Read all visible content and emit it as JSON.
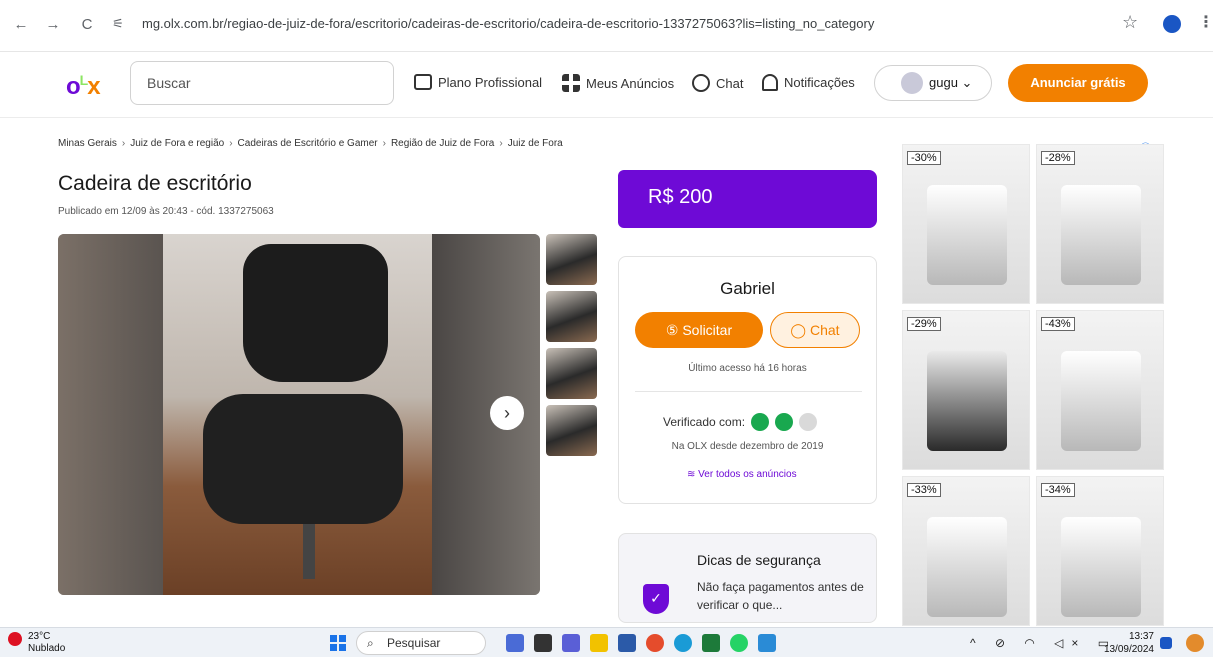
{
  "browser": {
    "url": "mg.olx.com.br/regiao-de-juiz-de-fora/escritorio/cadeiras-de-escritorio/cadeira-de-escritorio-1337275063?lis=listing_no_category",
    "back_icon": "←",
    "forward_icon": "→",
    "reload_icon": "C",
    "tune_icon": "⚟",
    "star_icon": "☆",
    "menu_icon": "⋮"
  },
  "header": {
    "search_placeholder": "Buscar",
    "nav": [
      "Plano Profissional",
      "Meus Anúncios",
      "Chat",
      "Notificações"
    ],
    "user": "gugu ⌄",
    "cta": "Anunciar grátis",
    "brand_colors": {
      "purple": "#6e0ad6",
      "orange": "#f28000",
      "green": "#8ce563"
    }
  },
  "breadcrumb": [
    "Minas Gerais",
    "Juiz de Fora e região",
    "Cadeiras de Escritório e Gamer",
    "Região de Juiz de Fora",
    "Juiz de Fora"
  ],
  "breadcrumb_sep": "›",
  "listing": {
    "title": "Cadeira de escritório",
    "published": "Publicado em 12/09 às 20:43 - cód. 1337275063",
    "price": "R$ 200",
    "next_icon": "›"
  },
  "seller": {
    "name": "Gabriel",
    "solicitar": "Solicitar",
    "chat": "Chat",
    "last_access": "Último acesso há 16 horas",
    "verified_label": "Verificado com:",
    "since": "Na OLX desde dezembro de 2019",
    "all_ads": "Ver todos os anúncios"
  },
  "tips": {
    "title": "Dicas de segurança",
    "text": "Não faça pagamentos antes de verificar o que..."
  },
  "ads": {
    "badges": [
      "-30%",
      "-28%",
      "-29%",
      "-43%",
      "-33%",
      "-34%"
    ],
    "info_icon": "ⓘ✕"
  },
  "taskbar": {
    "temp": "23°C",
    "weather": "Nublado",
    "search": "Pesquisar",
    "time": "13:37",
    "date": "13/09/2024"
  }
}
